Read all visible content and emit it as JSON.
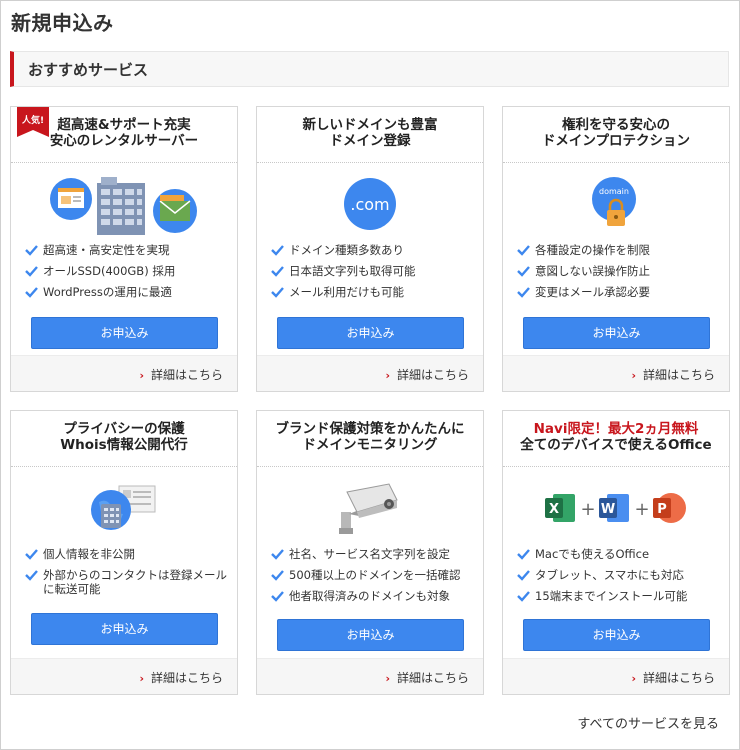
{
  "page": {
    "title": "新規申込み"
  },
  "section": {
    "title": "おすすめサービス"
  },
  "badge": {
    "text": "人気!"
  },
  "cards": [
    {
      "title_lines": [
        "超高速&サポート充実",
        "安心のレンタルサーバー"
      ],
      "icon": "rental-server-illustration",
      "features": [
        "超高速・高安定性を実現",
        "オールSSD(400GB) 採用",
        "WordPressの運用に最適"
      ],
      "button": "お申込み",
      "detail": "詳細はこちら"
    },
    {
      "title_lines": [
        "新しいドメインも豊富",
        "ドメイン登録"
      ],
      "icon": "dot-com-icon",
      "icon_text": ".com",
      "features": [
        "ドメイン種類多数あり",
        "日本語文字列も取得可能",
        "メール利用だけも可能"
      ],
      "button": "お申込み",
      "detail": "詳細はこちら"
    },
    {
      "title_lines": [
        "権利を守る安心の",
        "ドメインプロテクション"
      ],
      "icon": "domain-lock-icon",
      "icon_text": "domain",
      "features": [
        "各種設定の操作を制限",
        "意図しない誤操作防止",
        "変更はメール承認必要"
      ],
      "button": "お申込み",
      "detail": "詳細はこちら"
    },
    {
      "title_lines": [
        "プライバシーの保護",
        "Whois情報公開代行"
      ],
      "icon": "privacy-lock-globe-icon",
      "features": [
        "個人情報を非公開",
        "外部からのコンタクトは登録メールに転送可能"
      ],
      "button": "お申込み",
      "detail": "詳細はこちら"
    },
    {
      "title_lines": [
        "ブランド保護対策をかんたんに",
        "ドメインモニタリング"
      ],
      "icon": "security-camera-icon",
      "features": [
        "社名、サービス名文字列を設定",
        "500種以上のドメインを一括確認",
        "他者取得済みのドメインも対象"
      ],
      "button": "お申込み",
      "detail": "詳細はこちら"
    },
    {
      "title_red": "Navi限定！最大2ヵ月無料",
      "title_lines": [
        "全てのデバイスで使えるOffice"
      ],
      "icon": "office-apps-icon",
      "office_letters": [
        "X",
        "W",
        "P"
      ],
      "features": [
        "Macでも使えるOffice",
        "タブレット、スマホにも対応",
        "15端末までインストール可能"
      ],
      "button": "お申込み",
      "detail": "詳細はこちら"
    }
  ],
  "footer": {
    "all_services": "すべてのサービスを見る"
  },
  "colors": {
    "accent_red": "#c8161d",
    "button_blue": "#3d87ee",
    "check_blue": "#3d87ee"
  }
}
